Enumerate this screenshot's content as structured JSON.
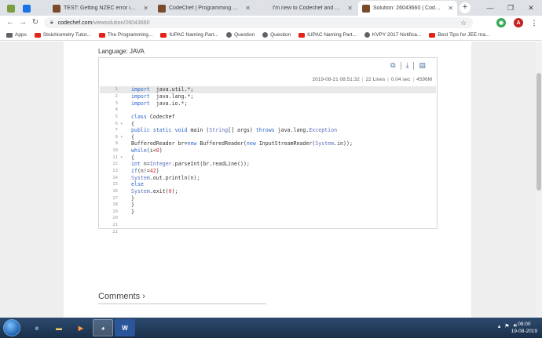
{
  "browser": {
    "tabs": [
      {
        "title": "",
        "favicon": "k",
        "active": false
      },
      {
        "title": "",
        "favicon": "b",
        "active": false
      },
      {
        "title": "TEST: Getting NZEC error in java",
        "favicon": "cc",
        "active": false
      },
      {
        "title": "CodeChef | Programming Compe",
        "favicon": "cc",
        "active": false
      },
      {
        "title": "I'm new to Codechef and my first",
        "favicon": "d",
        "active": false
      },
      {
        "title": "Solution: 26043660 | CodeChef",
        "favicon": "cc",
        "active": true
      }
    ],
    "url_host": "codechef.com",
    "url_path": "/viewsolution/26043660",
    "profile_initial": "A"
  },
  "bookmarks": [
    {
      "label": "Apps",
      "icon": "apps-grid-icon"
    },
    {
      "label": "Stoichiometry Tutor...",
      "icon": "youtube-icon"
    },
    {
      "label": "The Programming...",
      "icon": "youtube-icon"
    },
    {
      "label": "IUPAC Naming Part...",
      "icon": "youtube-icon"
    },
    {
      "label": "Question",
      "icon": "globe-icon"
    },
    {
      "label": "Question",
      "icon": "globe-icon"
    },
    {
      "label": "IUPAC Naming Part...",
      "icon": "youtube-icon"
    },
    {
      "label": "KVPY 2017 Notifica...",
      "icon": "globe-icon"
    },
    {
      "label": "Best Tips for JEE ma...",
      "icon": "youtube-icon"
    }
  ],
  "solution": {
    "language_label": "Language: JAVA",
    "timestamp": "2019-08-21 08:51:32",
    "lines": "22 Lines",
    "time": "0.04 sec",
    "memory": "4596M",
    "code": [
      {
        "n": "1",
        "fold": "",
        "tokens": [
          [
            "kw",
            "import"
          ],
          [
            "",
            "  java.util.*;"
          ]
        ]
      },
      {
        "n": "2",
        "fold": "",
        "tokens": [
          [
            "kw",
            "import"
          ],
          [
            "",
            "  java.lang.*;"
          ]
        ]
      },
      {
        "n": "3",
        "fold": "",
        "tokens": [
          [
            "kw",
            "import"
          ],
          [
            "",
            "  java.io.*;"
          ]
        ]
      },
      {
        "n": "4",
        "fold": "",
        "tokens": []
      },
      {
        "n": "5",
        "fold": "",
        "tokens": [
          [
            "kw",
            "class"
          ],
          [
            "",
            " Codechef"
          ]
        ]
      },
      {
        "n": "6",
        "fold": "▾",
        "tokens": [
          [
            "",
            "{"
          ]
        ]
      },
      {
        "n": "7",
        "fold": "",
        "tokens": [
          [
            "kw",
            "public static void"
          ],
          [
            "",
            " main ("
          ],
          [
            "ty",
            "String"
          ],
          [
            "",
            "[] args) "
          ],
          [
            "kw",
            "throws"
          ],
          [
            "",
            " java.lang."
          ],
          [
            "ty",
            "Exception"
          ]
        ]
      },
      {
        "n": "8",
        "fold": "▾",
        "tokens": [
          [
            "",
            "{"
          ]
        ]
      },
      {
        "n": "9",
        "fold": "",
        "tokens": [
          [
            "",
            "BufferedReader br="
          ],
          [
            "kw",
            "new"
          ],
          [
            "",
            " BufferedReader("
          ],
          [
            "kw",
            "new"
          ],
          [
            "",
            " InputStreamReader("
          ],
          [
            "ty",
            "System"
          ],
          [
            "",
            ".in));"
          ]
        ]
      },
      {
        "n": "10",
        "fold": "",
        "tokens": [
          [
            "kw",
            "while"
          ],
          [
            "",
            "(i<"
          ],
          [
            "num",
            "0"
          ],
          [
            "",
            ")"
          ]
        ]
      },
      {
        "n": "11",
        "fold": "▾",
        "tokens": [
          [
            "",
            "{"
          ]
        ]
      },
      {
        "n": "12",
        "fold": "",
        "tokens": [
          [
            "kw",
            "int"
          ],
          [
            "",
            " n="
          ],
          [
            "ty",
            "Integer"
          ],
          [
            "",
            ".parseInt(br.readLine());"
          ]
        ]
      },
      {
        "n": "13",
        "fold": "",
        "tokens": [
          [
            "kw",
            "if"
          ],
          [
            "",
            "(n!="
          ],
          [
            "num",
            "42"
          ],
          [
            "",
            ")"
          ]
        ]
      },
      {
        "n": "14",
        "fold": "",
        "tokens": [
          [
            "ty",
            "System"
          ],
          [
            "",
            ".out.println(n);"
          ]
        ]
      },
      {
        "n": "15",
        "fold": "",
        "tokens": [
          [
            "kw",
            "else"
          ]
        ]
      },
      {
        "n": "16",
        "fold": "",
        "tokens": [
          [
            "ty",
            "System"
          ],
          [
            "",
            ".exit("
          ],
          [
            "num",
            "0"
          ],
          [
            "",
            ");"
          ]
        ]
      },
      {
        "n": "17",
        "fold": "",
        "tokens": [
          [
            "",
            "}"
          ]
        ]
      },
      {
        "n": "18",
        "fold": "",
        "tokens": [
          [
            "",
            "}"
          ]
        ]
      },
      {
        "n": "19",
        "fold": "",
        "tokens": [
          [
            "",
            "}"
          ]
        ]
      },
      {
        "n": "20",
        "fold": "",
        "tokens": []
      },
      {
        "n": "21",
        "fold": "",
        "tokens": []
      },
      {
        "n": "22",
        "fold": "",
        "tokens": []
      }
    ],
    "comments_label": "Comments ›"
  },
  "taskbar": {
    "time": "08:00",
    "date": "19-08-2019"
  }
}
